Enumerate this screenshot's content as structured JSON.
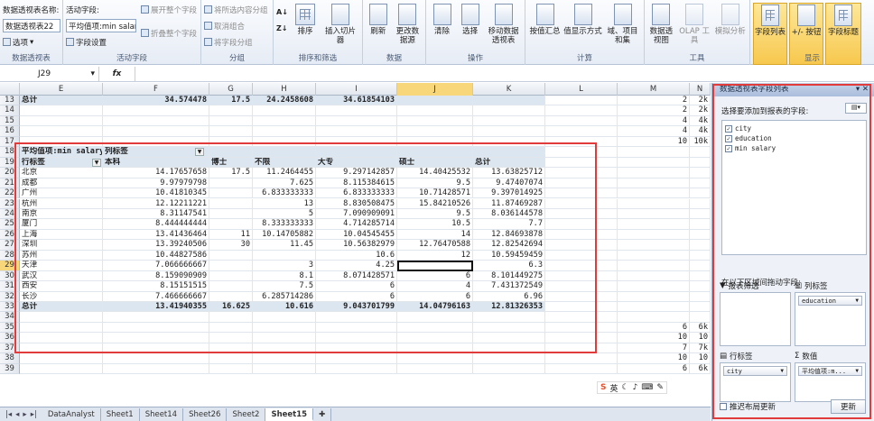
{
  "ribbon": {
    "groups": [
      {
        "label": "数据透视表",
        "name_label": "数据透视表名称:",
        "name_value": "数据透视表22",
        "options": "选项"
      },
      {
        "label": "活动字段",
        "field_label": "活动字段:",
        "field_value": "平均值项:min salar",
        "field_settings": "字段设置",
        "expand": "展开整个字段",
        "collapse": "折叠整个字段"
      },
      {
        "label": "分组",
        "group_selection": "将所选内容分组",
        "ungroup": "取消组合",
        "group_field": "将字段分组"
      },
      {
        "label": "排序和筛选",
        "sort": "排序",
        "insert_slicer": "插入切片器"
      },
      {
        "label": "数据",
        "refresh": "刷新",
        "change_source": "更改数据源"
      },
      {
        "label": "操作",
        "clear": "清除",
        "select": "选择",
        "move": "移动数据透视表"
      },
      {
        "label": "计算",
        "summarize": "按值汇总",
        "show_values": "值显示方式",
        "fields_items": "域、项目和集"
      },
      {
        "label": "工具",
        "pivot_chart": "数据透视图",
        "olap": "OLAP 工具",
        "what_if": "模拟分析"
      },
      {
        "label": "显示",
        "field_list": "字段列表",
        "buttons": "+/- 按钮",
        "headers": "字段标题"
      }
    ]
  },
  "formula_bar": {
    "name_box": "J29",
    "fx": "fx",
    "formula": ""
  },
  "columns": [
    "E",
    "F",
    "G",
    "H",
    "I",
    "J",
    "K",
    "L",
    "M",
    "N"
  ],
  "rows": [
    {
      "n": "13",
      "cells": [
        "总计",
        "34.574478",
        "17.5",
        "24.2458608",
        "34.61854103",
        "",
        "",
        "",
        "2",
        "2k"
      ]
    },
    {
      "n": "14",
      "cells": [
        "",
        "",
        "",
        "",
        "",
        "",
        "",
        "",
        "2",
        "2k"
      ]
    },
    {
      "n": "15",
      "cells": [
        "",
        "",
        "",
        "",
        "",
        "",
        "",
        "",
        "4",
        "4k"
      ]
    },
    {
      "n": "16",
      "cells": [
        "",
        "",
        "",
        "",
        "",
        "",
        "",
        "",
        "4",
        "4k"
      ]
    },
    {
      "n": "17",
      "cells": [
        "",
        "",
        "",
        "",
        "",
        "",
        "",
        "",
        "10",
        "10k"
      ]
    },
    {
      "n": "18",
      "cells": [
        "平均值项:min salary",
        "列标签",
        "",
        "",
        "",
        "",
        "",
        "",
        "",
        ""
      ]
    },
    {
      "n": "19",
      "cells": [
        "行标签",
        "本科",
        "博士",
        "不限",
        "大专",
        "硕士",
        "总计",
        "",
        "",
        ""
      ]
    },
    {
      "n": "20",
      "cells": [
        "北京",
        "14.17657658",
        "17.5",
        "11.2464455",
        "9.297142857",
        "14.40425532",
        "13.63825712",
        "",
        "",
        ""
      ]
    },
    {
      "n": "21",
      "cells": [
        "成都",
        "9.97979798",
        "",
        "7.625",
        "8.115384615",
        "9.5",
        "9.47407074",
        "",
        "",
        ""
      ]
    },
    {
      "n": "22",
      "cells": [
        "广州",
        "10.41810345",
        "",
        "6.833333333",
        "6.833333333",
        "10.71428571",
        "9.397014925",
        "",
        "",
        ""
      ]
    },
    {
      "n": "23",
      "cells": [
        "杭州",
        "12.12211221",
        "",
        "13",
        "8.830508475",
        "15.84210526",
        "11.87469287",
        "",
        "",
        ""
      ]
    },
    {
      "n": "24",
      "cells": [
        "南京",
        "8.31147541",
        "",
        "5",
        "7.090909091",
        "9.5",
        "8.036144578",
        "",
        "",
        ""
      ]
    },
    {
      "n": "25",
      "cells": [
        "厦门",
        "8.444444444",
        "",
        "8.333333333",
        "4.714285714",
        "10.5",
        "7.7",
        "",
        "",
        ""
      ]
    },
    {
      "n": "26",
      "cells": [
        "上海",
        "13.41436464",
        "11",
        "10.14705882",
        "10.04545455",
        "14",
        "12.84693878",
        "",
        "",
        ""
      ]
    },
    {
      "n": "27",
      "cells": [
        "深圳",
        "13.39240506",
        "30",
        "11.45",
        "10.56382979",
        "12.76470588",
        "12.82542694",
        "",
        "",
        ""
      ]
    },
    {
      "n": "28",
      "cells": [
        "苏州",
        "10.44827586",
        "",
        "",
        "10.6",
        "12",
        "10.59459459",
        "",
        "",
        ""
      ]
    },
    {
      "n": "29",
      "cells": [
        "天津",
        "7.066666667",
        "",
        "3",
        "4.25",
        "",
        "6.3",
        "",
        "",
        ""
      ]
    },
    {
      "n": "30",
      "cells": [
        "武汉",
        "8.159090909",
        "",
        "8.1",
        "8.071428571",
        "6",
        "8.101449275",
        "",
        "",
        ""
      ]
    },
    {
      "n": "31",
      "cells": [
        "西安",
        "8.15151515",
        "",
        "7.5",
        "6",
        "4",
        "7.431372549",
        "",
        "",
        ""
      ]
    },
    {
      "n": "32",
      "cells": [
        "长沙",
        "7.466666667",
        "",
        "6.285714286",
        "6",
        "6",
        "6.96",
        "",
        "",
        ""
      ]
    },
    {
      "n": "33",
      "cells": [
        "总计",
        "13.41940355",
        "16.625",
        "10.616",
        "9.043701799",
        "14.04796163",
        "12.81326353",
        "",
        "",
        ""
      ]
    },
    {
      "n": "34",
      "cells": [
        "",
        "",
        "",
        "",
        "",
        "",
        "",
        "",
        "",
        ""
      ]
    },
    {
      "n": "35",
      "cells": [
        "",
        "",
        "",
        "",
        "",
        "",
        "",
        "",
        "6",
        "6k"
      ]
    },
    {
      "n": "36",
      "cells": [
        "",
        "",
        "",
        "",
        "",
        "",
        "",
        "",
        "10",
        "10"
      ]
    },
    {
      "n": "37",
      "cells": [
        "",
        "",
        "",
        "",
        "",
        "",
        "",
        "",
        "7",
        "7k"
      ]
    },
    {
      "n": "38",
      "cells": [
        "",
        "",
        "",
        "",
        "",
        "",
        "",
        "",
        "10",
        "10"
      ]
    },
    {
      "n": "39",
      "cells": [
        "",
        "",
        "",
        "",
        "",
        "",
        "",
        "",
        "6",
        "6k"
      ]
    }
  ],
  "sheets": [
    "DataAnalyst",
    "Sheet1",
    "Sheet14",
    "Sheet26",
    "Sheet2",
    "Sheet15"
  ],
  "active_sheet": "Sheet15",
  "panel": {
    "title": "数据透视表字段列表",
    "choose_label": "选择要添加到报表的字段:",
    "fields": [
      {
        "name": "city",
        "checked": true
      },
      {
        "name": "education",
        "checked": true
      },
      {
        "name": "min salary",
        "checked": true
      }
    ],
    "drag_label": "在以下区域间拖动字段:",
    "report_filter": "报表筛选",
    "column_labels": "列标签",
    "row_labels": "行标签",
    "values": "数值",
    "column_chip": "education",
    "row_chip": "city",
    "value_chip": "平均值项:m...",
    "defer": "推迟布局更新",
    "update": "更新"
  },
  "ime": {
    "label": "英"
  }
}
